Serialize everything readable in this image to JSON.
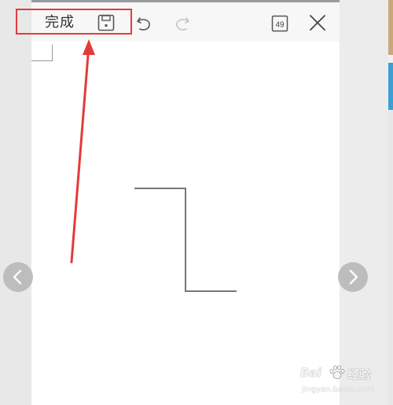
{
  "toolbar": {
    "done_label": "完成",
    "page_badge": "49"
  },
  "icons": {
    "save": "save-icon",
    "undo": "undo-icon",
    "redo": "redo-icon",
    "page": "page-count-icon",
    "close": "close-icon",
    "prev": "chevron-left-icon",
    "next": "chevron-right-icon"
  },
  "annotation": {
    "color": "#e53a3a"
  },
  "watermark": {
    "line1_pre": "Bai",
    "line1_post": "经验",
    "line2": "jingyan.baidu.com"
  },
  "colors": {
    "toolbar_bg": "#f7f7f7",
    "canvas_bg": "#ffffff",
    "stroke": "#777777",
    "highlight": "#e53a3a"
  }
}
